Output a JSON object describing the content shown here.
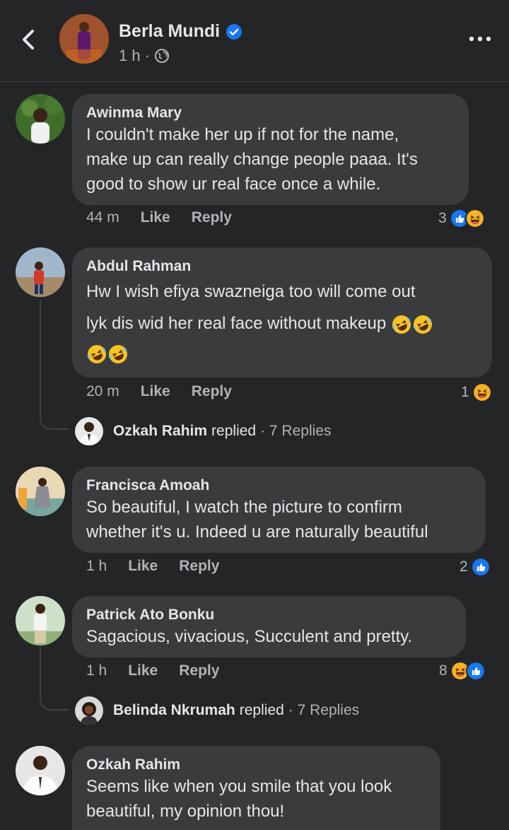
{
  "header": {
    "name": "Berla Mundi",
    "time": "1 h",
    "separator": "·"
  },
  "comments": [
    {
      "author": "Awinma Mary",
      "lines": [
        "I couldn't make her up if not for the name,",
        "make up can really change people paaa. It's",
        "good to show ur real face once a while."
      ],
      "time": "44 m",
      "like": "Like",
      "reply": "Reply",
      "reaction_count": "3",
      "reactions": [
        "like-icon",
        "haha-icon"
      ]
    },
    {
      "author": "Abdul Rahman",
      "lines": [
        "Hw I wish efiya swazneiga too will come out",
        "lyk dis wid her real face without makeup"
      ],
      "emoji": "rolling-laughing-emoji",
      "time": "20 m",
      "like": "Like",
      "reply": "Reply",
      "reaction_count": "1",
      "reactions": [
        "haha-icon"
      ],
      "replied": {
        "name": "Ozkah Rahim",
        "verb": "replied",
        "count": "· 7 Replies"
      }
    },
    {
      "author": "Francisca Amoah",
      "lines": [
        "So beautiful, I watch the picture to confirm",
        "whether it's u. Indeed u are naturally beautiful"
      ],
      "time": "1 h",
      "like": "Like",
      "reply": "Reply",
      "reaction_count": "2",
      "reactions": [
        "like-icon"
      ]
    },
    {
      "author": "Patrick Ato Bonku",
      "lines": [
        "Sagacious, vivacious, Succulent and pretty."
      ],
      "time": "1 h",
      "like": "Like",
      "reply": "Reply",
      "reaction_count": "8",
      "reactions": [
        "haha-icon",
        "like-icon"
      ],
      "replied": {
        "name": "Belinda Nkrumah",
        "verb": "replied",
        "count": "· 7 Replies"
      }
    },
    {
      "author": "Ozkah Rahim",
      "lines": [
        "Seems like when you smile that you look",
        "beautiful, my opinion thou!"
      ]
    }
  ],
  "colors": {
    "background": "#242526",
    "bubble": "#3a3b3c",
    "text": "#e4e6eb",
    "muted": "#b0b3b8",
    "like_blue": "#1877f2",
    "haha_yellow": "#f7b125"
  }
}
